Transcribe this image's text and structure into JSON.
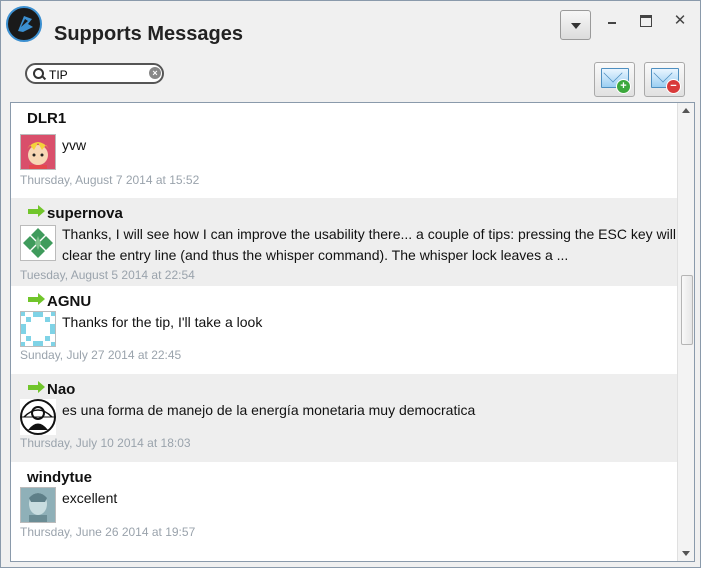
{
  "window": {
    "title": "Supports Messages"
  },
  "search": {
    "value": "TIP"
  },
  "messages": [
    {
      "sender": "DLR1",
      "arrow": false,
      "text": "yvw",
      "time": "Thursday, August 7 2014 at 15:52",
      "avatar": "cartoon-boy-avatar"
    },
    {
      "sender": "supernova",
      "arrow": true,
      "text": "Thanks,  I will see how I can improve the usability there...   a couple of tips: pressing the ESC key will clear the entry line (and thus the whisper command).  The whisper lock leaves a ...",
      "time": "Tuesday, August 5 2014 at 22:54",
      "avatar": "green-pattern-avatar"
    },
    {
      "sender": "AGNU",
      "arrow": true,
      "text": "Thanks for the tip,  I'll take a look",
      "time": "Sunday, July 27 2014 at 22:45",
      "avatar": "blue-pixel-avatar"
    },
    {
      "sender": "Nao",
      "arrow": true,
      "text": "es una forma de manejo de la energía monetaria muy democratica",
      "time": "Thursday, July 10 2014 at 18:03",
      "avatar": "anonymous-mask-avatar"
    },
    {
      "sender": "windytue",
      "arrow": false,
      "text": "excellent",
      "time": "Thursday, June 26 2014 at 19:57",
      "avatar": "photo-avatar"
    }
  ],
  "colors": {
    "accent": "#3b8fd0",
    "arrow": "#71c52b",
    "timestamp": "#9aa3ac",
    "row_alt": "#eeeeee"
  }
}
